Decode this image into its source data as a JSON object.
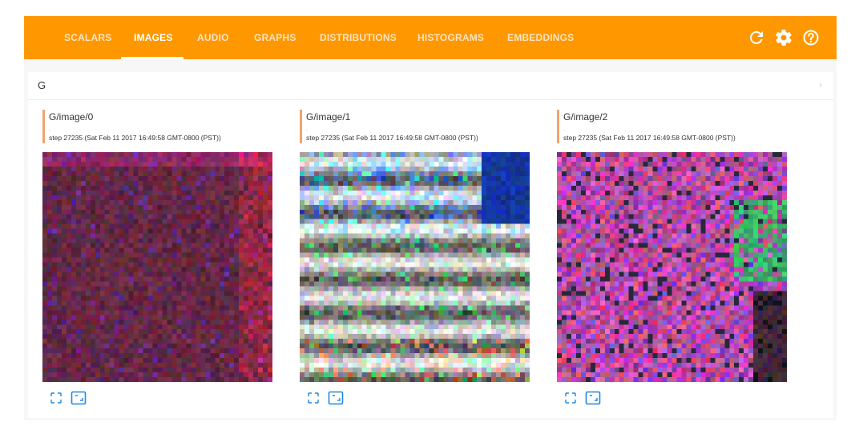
{
  "nav": {
    "tabs": [
      {
        "label": "SCALARS",
        "active": false
      },
      {
        "label": "IMAGES",
        "active": true
      },
      {
        "label": "AUDIO",
        "active": false
      },
      {
        "label": "GRAPHS",
        "active": false
      },
      {
        "label": "DISTRIBUTIONS",
        "active": false
      },
      {
        "label": "HISTOGRAMS",
        "active": false
      },
      {
        "label": "EMBEDDINGS",
        "active": false
      }
    ],
    "icons": [
      "refresh-icon",
      "settings-icon",
      "help-icon"
    ]
  },
  "group": {
    "title": "G",
    "chevron": "›"
  },
  "images": [
    {
      "title": "G/image/0",
      "dot": ".",
      "step": "step 27235 (Sat Feb 11 2017 16:49:58 GMT-0800 (PST))"
    },
    {
      "title": "G/image/1",
      "dot": ".",
      "step": "step 27235 (Sat Feb 11 2017 16:49:58 GMT-0800 (PST))"
    },
    {
      "title": "G/image/2",
      "dot": ".",
      "step": "step 27235 (Sat Feb 11 2017 16:49:58 GMT-0800 (PST))"
    }
  ],
  "colors": {
    "toolbar": "#ff9800",
    "accent_bar": "#f2a36b",
    "action_icon": "#1e88e5"
  }
}
